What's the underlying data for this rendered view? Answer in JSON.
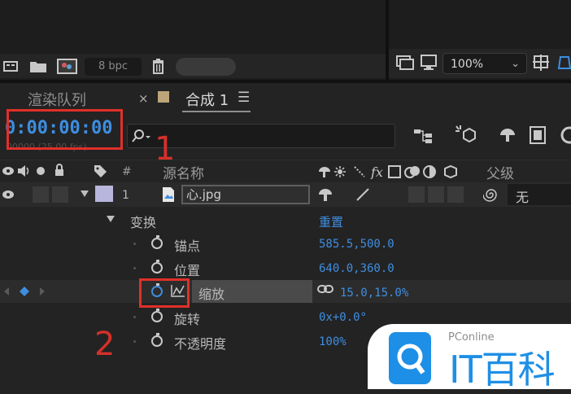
{
  "toolbar": {
    "bpc_label": "8 bpc",
    "zoom_value": "100%"
  },
  "tabs": {
    "render_queue": "渲染队列",
    "comp": "合成 1",
    "close_glyph": "×",
    "menu_glyph": "☰"
  },
  "timeline": {
    "timecode": "0:00:00:00",
    "fps": "00000 (25.00 fps)"
  },
  "columns": {
    "hash": "#",
    "source_name": "源名称",
    "parent": "父级"
  },
  "layer": {
    "index": "1",
    "name": "心.jpg",
    "parent_value": "无"
  },
  "transform": {
    "label": "变换",
    "reset": "重置",
    "properties": [
      {
        "label": "锚点",
        "value": "585.5,500.0"
      },
      {
        "label": "位置",
        "value": "640.0,360.0"
      },
      {
        "label": "缩放",
        "value": "15.0,15.0%"
      },
      {
        "label": "旋转",
        "value": "0x+0.0°"
      },
      {
        "label": "不透明度",
        "value": "100%"
      }
    ]
  },
  "annotations": {
    "one": "1",
    "two": "2",
    "color": "#e0302a"
  },
  "watermark": {
    "small": "PConline",
    "big": "IT百科"
  },
  "colors": {
    "accent_blue": "#3d8ee0",
    "bg": "#232323"
  }
}
